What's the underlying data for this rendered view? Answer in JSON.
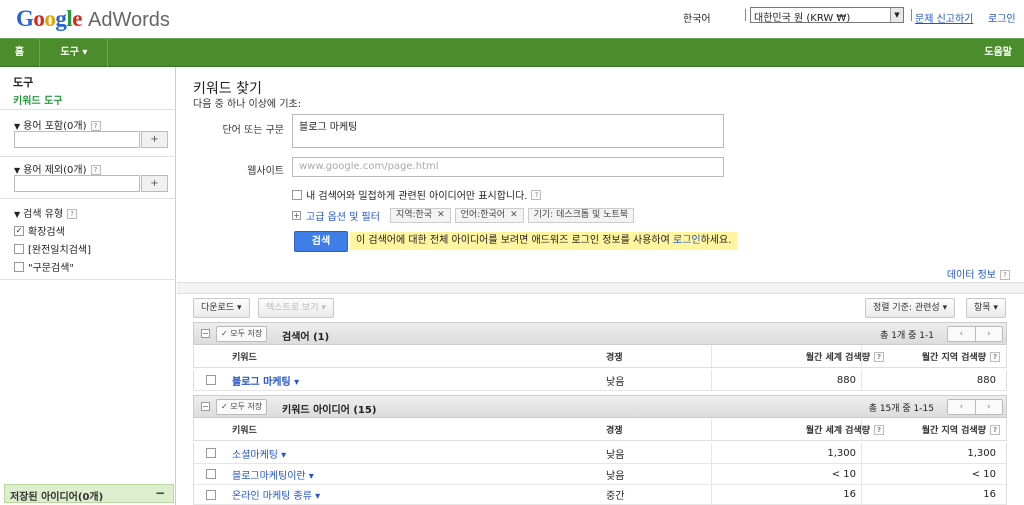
{
  "header": {
    "logo_google": [
      "G",
      "o",
      "o",
      "g",
      "l",
      "e"
    ],
    "logo_product": "AdWords",
    "language": "한국어",
    "currency": "대한민국 원 (KRW ₩)",
    "report_issue": "문제 신고하기",
    "login": "로그인"
  },
  "nav": {
    "home": "홈",
    "tools": "도구 ▾",
    "help": "도움말"
  },
  "sidebar": {
    "title": "도구",
    "subtitle": "키워드 도구",
    "include_label": "용어 포함(0개)",
    "exclude_label": "용어 제외(0개)",
    "plus": "+",
    "match_type_label": "검색 유형",
    "match_types": [
      {
        "label": "확장검색",
        "checked": true
      },
      {
        "label": "[완전일치검색]",
        "checked": false
      },
      {
        "label": "\"구문검색\"",
        "checked": false
      }
    ],
    "saved_ideas": "저장된 아이디어(0개)",
    "saved_toggle": "−"
  },
  "main": {
    "title": "키워드 찾기",
    "subtitle": "다음 중 하나 이상에 기초:",
    "phrase_label": "단어 또는 구문",
    "phrase_value": "블로그 마케팅",
    "website_label": "웹사이트",
    "website_placeholder": "www.google.com/page.html",
    "only_related": "내 검색어와 밀접하게 관련된 아이디어만 표시합니다.",
    "advanced": "고급 옵션 및 필터",
    "chips": [
      "지역:한국",
      "언어:한국어",
      "기기: 데스크톱 및 노트북"
    ],
    "search_button": "검색",
    "notice_text": "이 검색어에 대한 전체 아이디어를 보려면 애드워즈 로그인 정보를 사용하여 ",
    "notice_link": "로그인",
    "notice_tail": "하세요.",
    "data_info": "데이터 정보"
  },
  "toolbar": {
    "download": "다운로드 ▾",
    "view_text": "텍스트로 보기 ▾",
    "sort": "정렬 기준: 관련성 ▾",
    "columns": "항목 ▾"
  },
  "columns": {
    "keyword": "키워드",
    "competition": "경쟁",
    "global": "월간 세계 검색량",
    "local": "월간 지역 검색량"
  },
  "search_terms": {
    "save_all": "✓ 모두 저장",
    "title": "검색어 (1)",
    "count": "총 1개 중 1-1",
    "rows": [
      {
        "keyword": "블로그 마케팅 ▾",
        "competition": "낮음",
        "global": "880",
        "local": "880"
      }
    ]
  },
  "keyword_ideas": {
    "save_all": "✓ 모두 저장",
    "title": "키워드 아이디어 (15)",
    "count": "총 15개 중 1-15",
    "rows": [
      {
        "keyword": "소셜마케팅 ▾",
        "competition": "낮음",
        "global": "1,300",
        "local": "1,300"
      },
      {
        "keyword": "블로그마케팅이란 ▾",
        "competition": "낮음",
        "global": "< 10",
        "local": "< 10"
      },
      {
        "keyword": "온라인 마케팅 종류 ▾",
        "competition": "중간",
        "global": "16",
        "local": "16"
      }
    ]
  },
  "pager": {
    "prev": "‹",
    "next": "›"
  },
  "help_glyph": "?",
  "colors": {
    "nav_green": "#4b8c2c",
    "link_blue": "#2255cc",
    "search_blue": "#3f7ee6",
    "notice_yellow": "#fff49f"
  }
}
